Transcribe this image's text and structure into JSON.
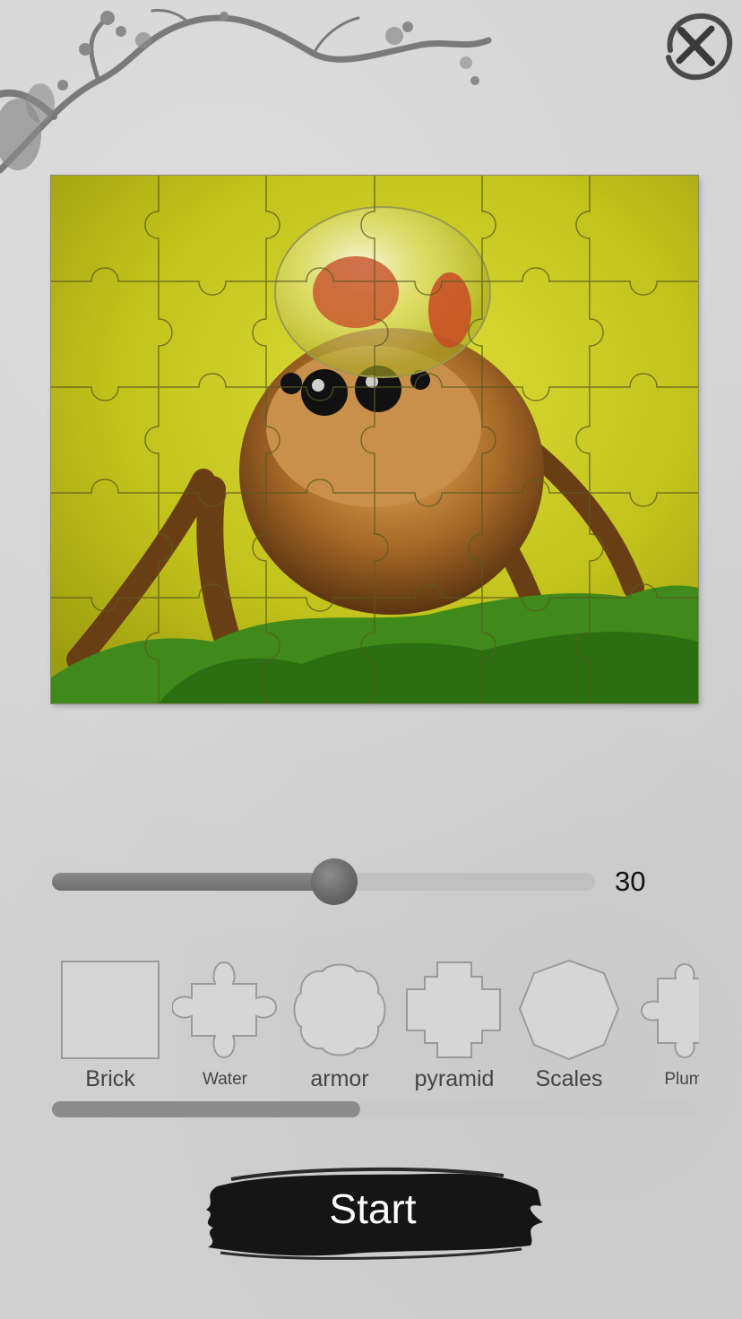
{
  "header": {
    "decoration": "plum-branch-icon",
    "close_icon": "close-icon"
  },
  "puzzle": {
    "image": "jumping-spider-with-water-droplet",
    "columns": 6,
    "rows": 5,
    "background_color": "#c8c81e"
  },
  "slider": {
    "value": "30",
    "fill_fraction": 0.52
  },
  "shapes": [
    {
      "label": "Brick",
      "icon": "brick-shape-icon"
    },
    {
      "label": "Water",
      "icon": "water-shape-icon"
    },
    {
      "label": "armor",
      "icon": "armor-shape-icon"
    },
    {
      "label": "pyramid",
      "icon": "pyramid-shape-icon"
    },
    {
      "label": "Scales",
      "icon": "scales-shape-icon"
    },
    {
      "label": "Plum",
      "icon": "plum-shape-icon"
    }
  ],
  "shape_scroll": {
    "position_fraction": 0.48
  },
  "start": {
    "label": "Start"
  }
}
